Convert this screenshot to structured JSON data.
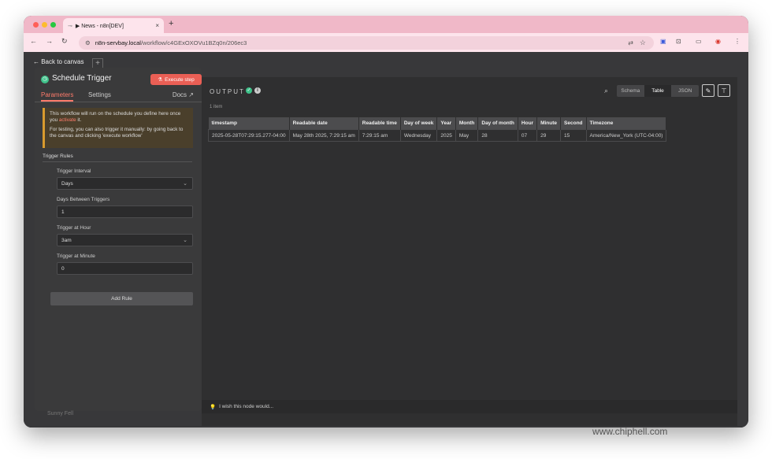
{
  "browser": {
    "tab_icon": "n8n-icon",
    "tab_title": "▶ News - n8n[DEV]",
    "tab_close": "×",
    "new_tab": "+",
    "url_host": "n8n-servbay.local",
    "url_path": "/workflow/c4GExOXOVu1BZq0n/206ec3"
  },
  "canvas": {
    "back_label": "← Back to canvas",
    "plus": "+",
    "bottom_name": "Sunny Fell"
  },
  "params": {
    "title": "Schedule Trigger",
    "execute_label": "Execute step",
    "tabs": [
      "Parameters",
      "Settings"
    ],
    "docs_label": "Docs",
    "notice_line1": "This workflow will run on the schedule you define here once you ",
    "notice_activate": "activate",
    "notice_line1_end": " it.",
    "notice_line2": "For testing, you can also trigger it manually: by going back to the canvas and clicking 'execute workflow'",
    "section_title": "Trigger Rules",
    "fields": {
      "interval_label": "Trigger Interval",
      "interval_value": "Days",
      "days_label": "Days Between Triggers",
      "days_value": "1",
      "hour_label": "Trigger at Hour",
      "hour_value": "3am",
      "minute_label": "Trigger at Minute",
      "minute_value": "0"
    },
    "add_rule": "Add Rule"
  },
  "output": {
    "title": "OUTPUT",
    "item_count": "1 item",
    "modes": [
      "Schema",
      "Table",
      "JSON"
    ],
    "active_mode": "Table",
    "columns": [
      "timestamp",
      "Readable date",
      "Readable time",
      "Day of week",
      "Year",
      "Month",
      "Day of month",
      "Hour",
      "Minute",
      "Second",
      "Timezone"
    ],
    "rows": [
      [
        "2025-05-28T07:29:15.277-04:00",
        "May 28th 2025, 7:29:15 am",
        "7:29:15 am",
        "Wednesday",
        "2025",
        "May",
        "28",
        "07",
        "29",
        "15",
        "America/New_York (UTC-04:00)"
      ]
    ],
    "feedback": "I wish this node would..."
  },
  "watermark": "www.chiphell.com"
}
